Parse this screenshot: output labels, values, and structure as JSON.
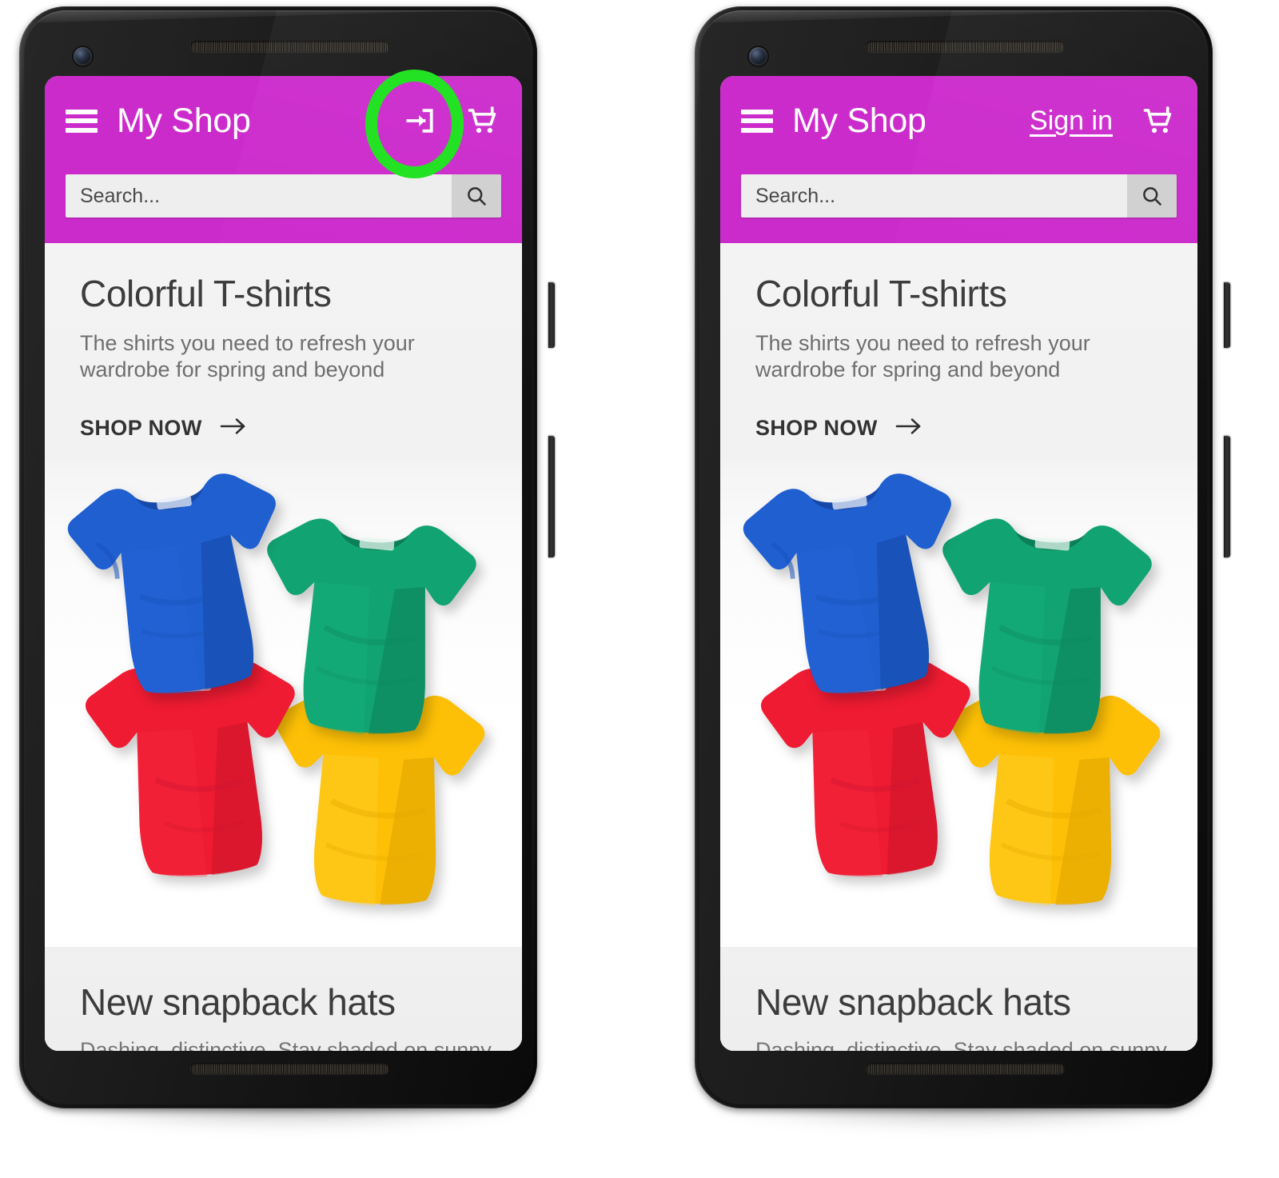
{
  "page": {
    "description": "Side-by-side mobile screenshots of the My Shop storefront: left phone shows a login arrow icon in the app bar, right phone shows a 'Sign in' text link; both are circled in green.",
    "highlight_color": "#23e223",
    "brand_color": "#cc2bcc"
  },
  "phones": [
    {
      "id": "left",
      "variant": "icon",
      "appbar": {
        "menu_icon": "hamburger-menu-icon",
        "title": "My Shop",
        "login_icon": "login-arrow-icon",
        "login_label": "",
        "cart_icon": "shopping-cart-icon"
      },
      "search": {
        "placeholder": "Search...",
        "value": "",
        "button_icon": "search-magnifier-icon"
      },
      "hero": {
        "title": "Colorful T-shirts",
        "subtitle": "The shirts you need to refresh your wardrobe for spring and beyond",
        "cta_label": "SHOP NOW",
        "cta_icon": "arrow-right-icon"
      },
      "shirts": [
        {
          "name": "blue-tshirt",
          "color": "#1a56c4"
        },
        {
          "name": "green-tshirt",
          "color": "#14a06a"
        },
        {
          "name": "red-tshirt",
          "color": "#ee1b32"
        },
        {
          "name": "yellow-tshirt",
          "color": "#ffc107"
        }
      ],
      "snapback": {
        "title": "New snapback hats",
        "subtitle": "Dashing, distinctive. Stay shaded on sunny"
      },
      "highlight": {
        "shape": "oval",
        "target": "login-arrow-icon"
      }
    },
    {
      "id": "right",
      "variant": "text",
      "appbar": {
        "menu_icon": "hamburger-menu-icon",
        "title": "My Shop",
        "login_icon": "",
        "login_label": "Sign in",
        "cart_icon": "shopping-cart-icon"
      },
      "search": {
        "placeholder": "Search...",
        "value": "",
        "button_icon": "search-magnifier-icon"
      },
      "hero": {
        "title": "Colorful T-shirts",
        "subtitle": "The shirts you need to refresh your wardrobe for spring and beyond",
        "cta_label": "SHOP NOW",
        "cta_icon": "arrow-right-icon"
      },
      "shirts": [
        {
          "name": "blue-tshirt",
          "color": "#1a56c4"
        },
        {
          "name": "green-tshirt",
          "color": "#14a06a"
        },
        {
          "name": "red-tshirt",
          "color": "#ee1b32"
        },
        {
          "name": "yellow-tshirt",
          "color": "#ffc107"
        }
      ],
      "snapback": {
        "title": "New snapback hats",
        "subtitle": "Dashing, distinctive. Stay shaded on sunny"
      },
      "highlight": {
        "shape": "circle",
        "target": "sign-in-link"
      }
    }
  ]
}
